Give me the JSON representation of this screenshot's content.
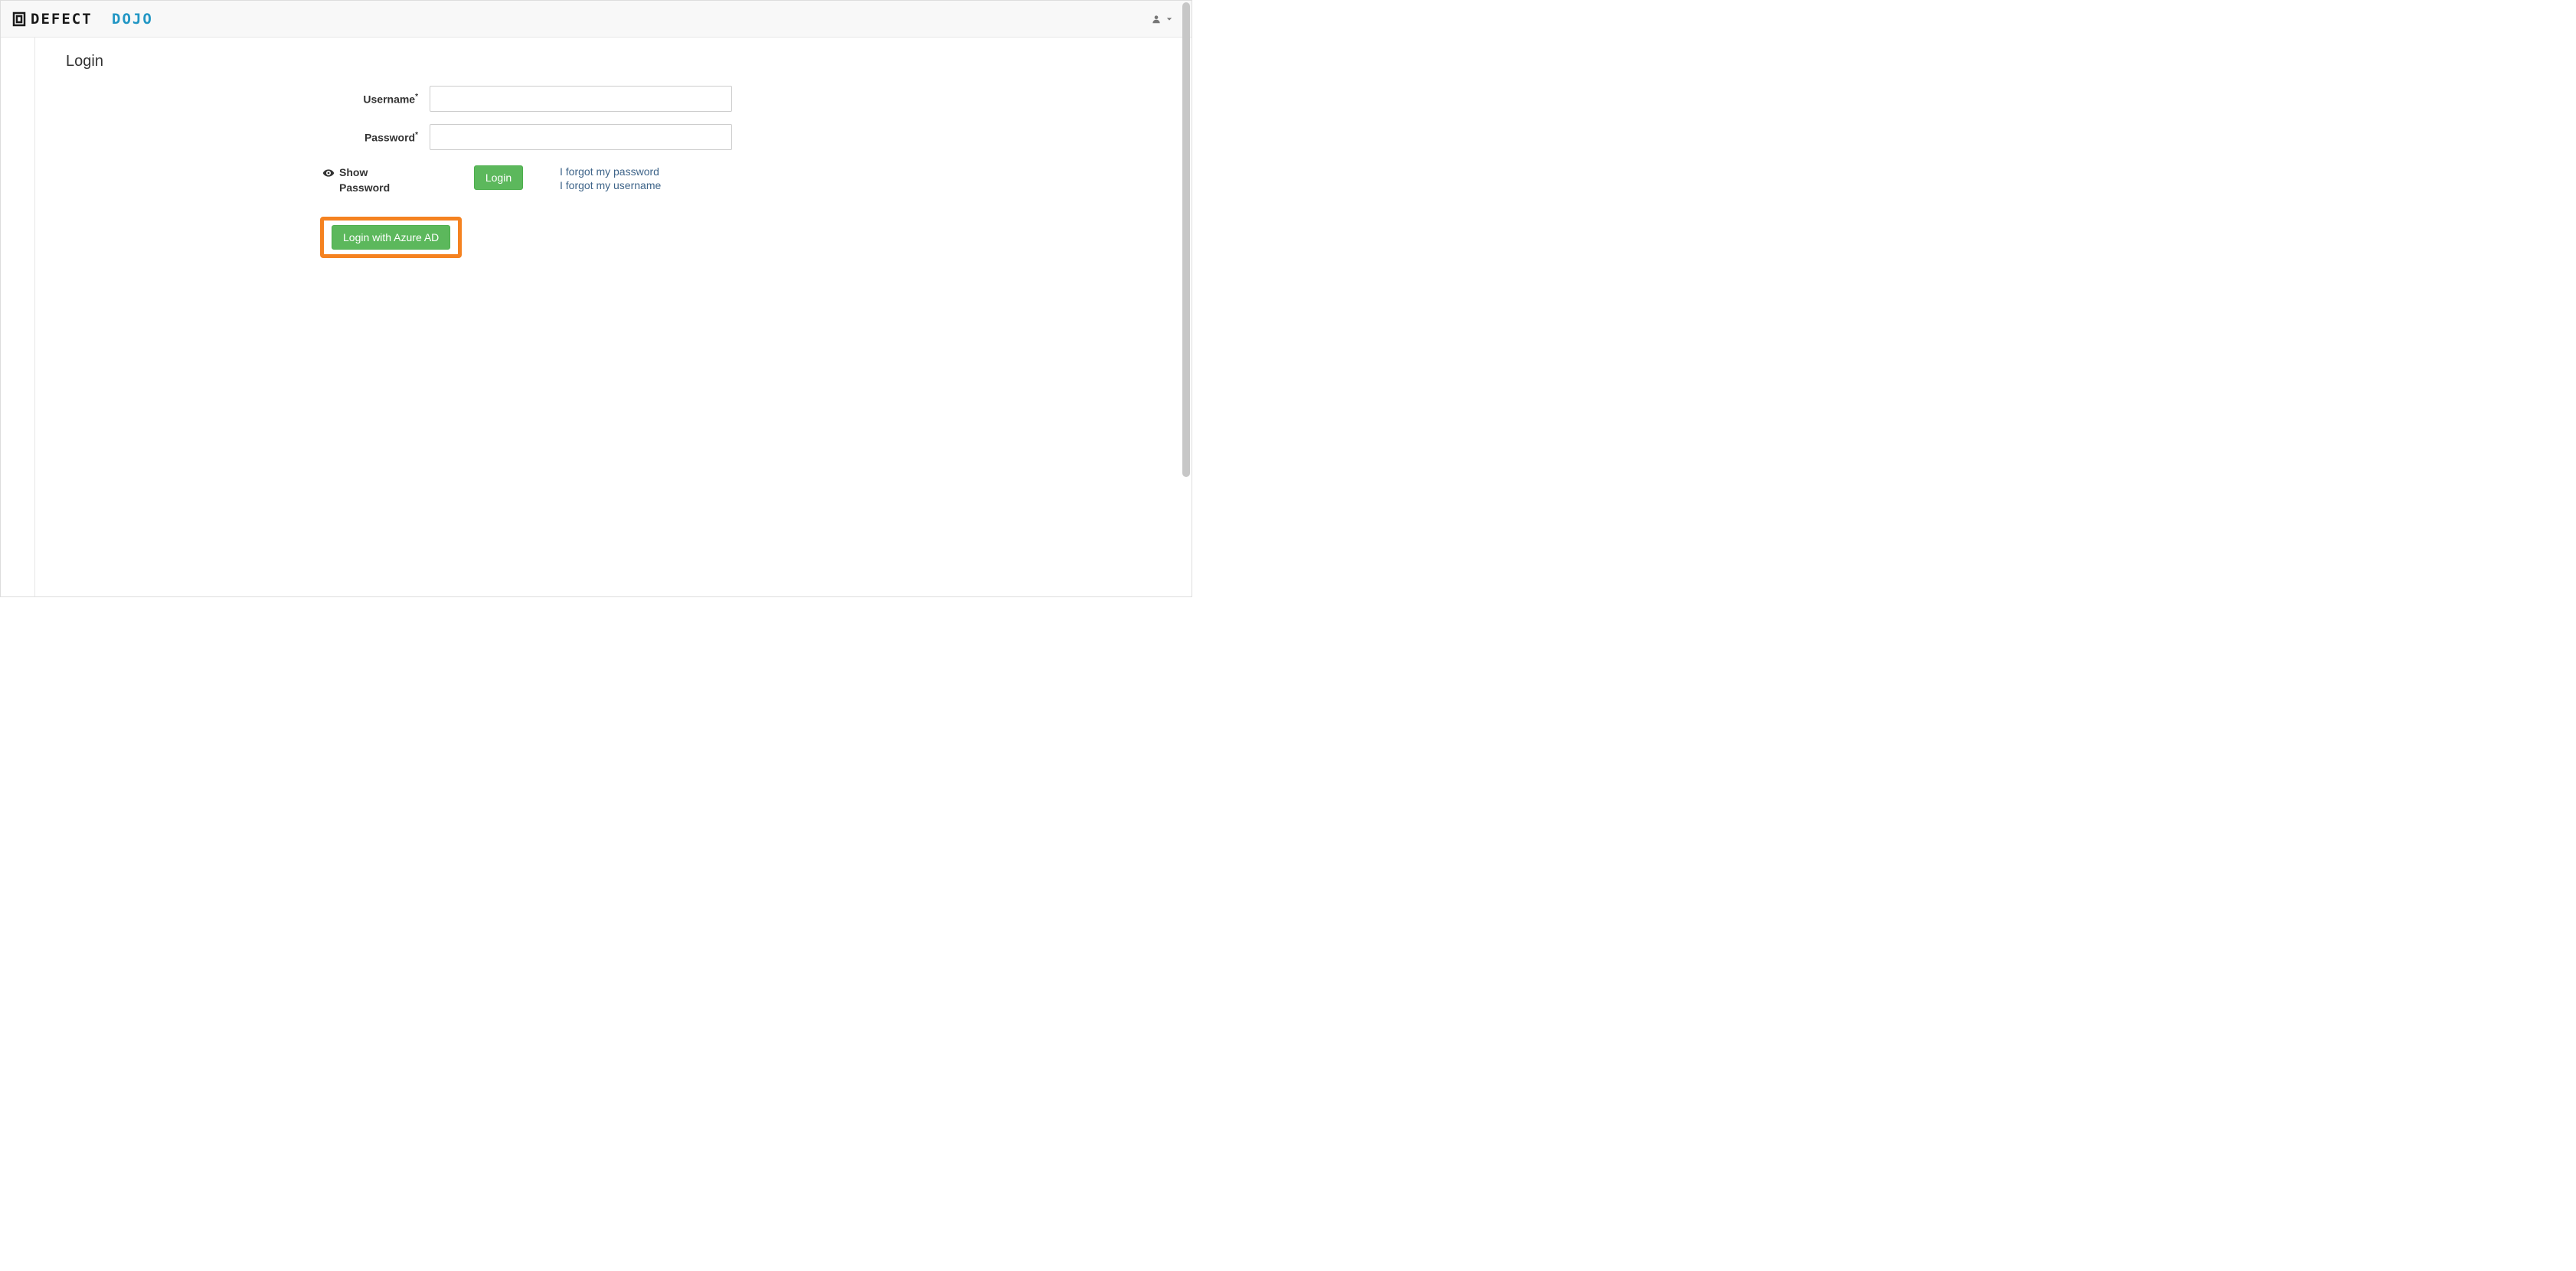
{
  "brand": {
    "text_dark": "DEFECT",
    "text_blue": "DOJO"
  },
  "page": {
    "title": "Login"
  },
  "form": {
    "username_label": "Username",
    "password_label": "Password",
    "required_mark": "*",
    "username_value": "",
    "password_value": "",
    "show_password_label": "Show Password",
    "login_button": "Login",
    "sso_button": "Login with Azure AD"
  },
  "links": {
    "forgot_password": "I forgot my password",
    "forgot_username": "I forgot my username"
  },
  "colors": {
    "highlight": "#f58220",
    "success": "#5cb85c",
    "link": "#3e6489",
    "brand_blue": "#2196c4"
  }
}
